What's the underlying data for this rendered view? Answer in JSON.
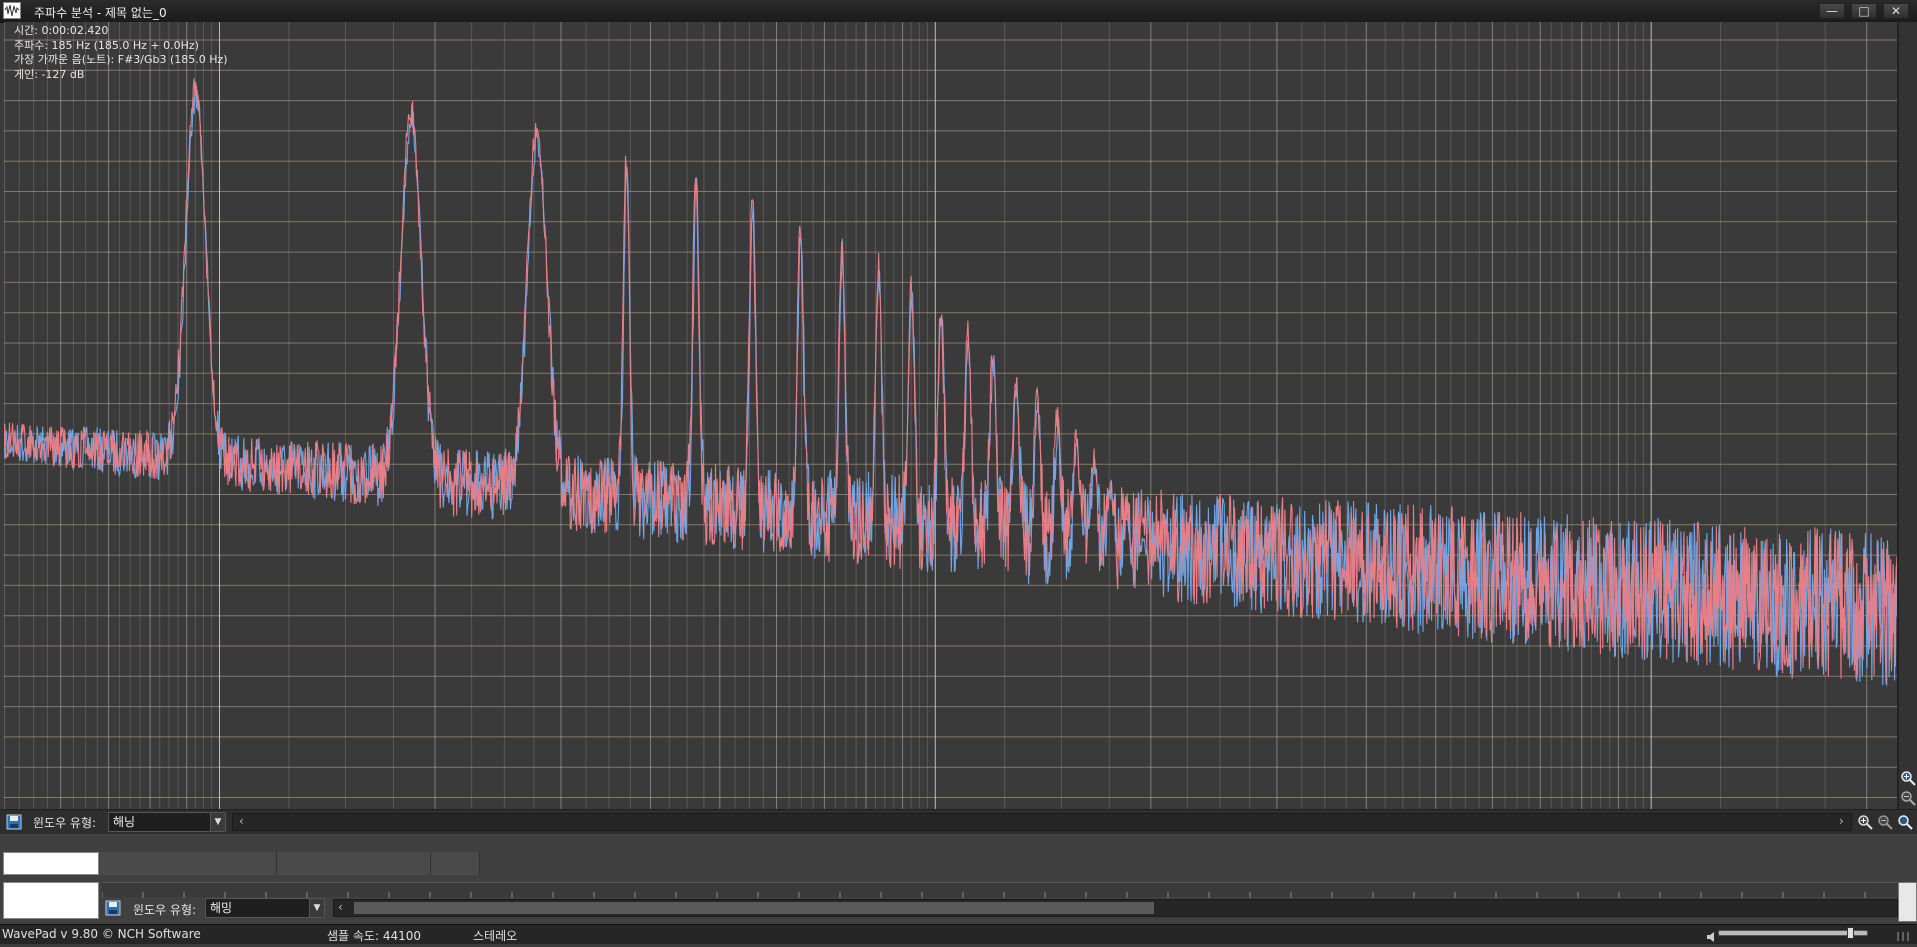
{
  "window": {
    "title": "주파수 분석 - 제목 없는_0",
    "minimize_glyph": "—",
    "maximize_glyph": "□",
    "close_glyph": "✕"
  },
  "readout": {
    "time": "시간: 0:00:02.420",
    "frequency": "주파수: 185 Hz (185.0 Hz + 0.0Hz)",
    "nearest_note": "가장 가까운 음(노트): F#3/Gb3 (185.0 Hz)",
    "gain": "게인: -127 dB"
  },
  "spectrum_controls": {
    "window_type_label": "윈도우 유형:",
    "window_type_value": "해닝",
    "scroll_left_glyph": "‹",
    "scroll_right_glyph": "›"
  },
  "lower_controls": {
    "window_type_label": "윈도우 유형:",
    "window_type_value": "해밍",
    "scroll_left_glyph": "‹"
  },
  "status": {
    "app_version": "WavePad v 9.80 © NCH Software",
    "sample_rate": "샘플 속도: 44100",
    "channels": "스테레오"
  },
  "colors": {
    "channel_left": "#e87e86",
    "channel_right": "#6fa6e6",
    "grid_vertical": "#d4d4d4",
    "grid_horizontal": "#c9a98a",
    "background": "#3a3a3a"
  },
  "icons": {
    "app": "waveform-icon",
    "zoom_in": "zoom-in-icon",
    "zoom_out": "zoom-out-icon",
    "zoom_fit": "zoom-fit-icon",
    "save": "save-icon",
    "volume": "speaker-icon"
  },
  "volume_level": 0.9
}
